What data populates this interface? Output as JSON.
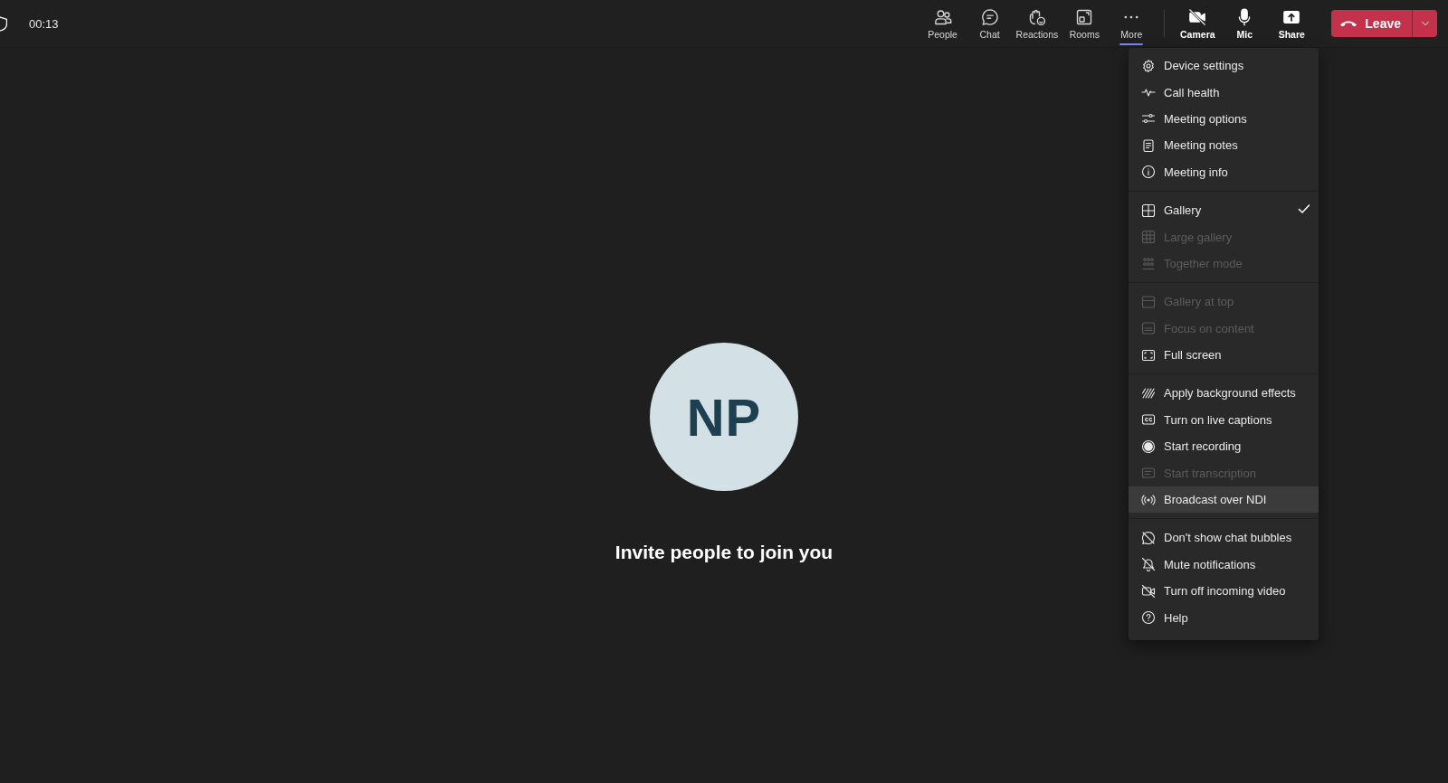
{
  "call": {
    "timer": "00:13"
  },
  "toolbar": [
    {
      "label": "People",
      "selected": false
    },
    {
      "label": "Chat",
      "selected": false
    },
    {
      "label": "Reactions",
      "selected": false
    },
    {
      "label": "Rooms",
      "selected": false
    },
    {
      "label": "More",
      "selected": true
    }
  ],
  "device_controls": [
    {
      "label": "Camera"
    },
    {
      "label": "Mic"
    },
    {
      "label": "Share"
    }
  ],
  "leave_button": {
    "label": "Leave"
  },
  "more_menu": {
    "groups": [
      {
        "items": [
          {
            "label": "Device settings",
            "checked": false,
            "disabled": false,
            "highlighted": false
          },
          {
            "label": "Call health",
            "checked": false,
            "disabled": false,
            "highlighted": false
          },
          {
            "label": "Meeting options",
            "checked": false,
            "disabled": false,
            "highlighted": false
          },
          {
            "label": "Meeting notes",
            "checked": false,
            "disabled": false,
            "highlighted": false
          },
          {
            "label": "Meeting info",
            "checked": false,
            "disabled": false,
            "highlighted": false
          }
        ]
      },
      {
        "items": [
          {
            "label": "Gallery",
            "checked": true,
            "disabled": false,
            "highlighted": false
          },
          {
            "label": "Large gallery",
            "checked": false,
            "disabled": true,
            "highlighted": false
          },
          {
            "label": "Together mode",
            "checked": false,
            "disabled": true,
            "highlighted": false
          }
        ]
      },
      {
        "items": [
          {
            "label": "Gallery at top",
            "checked": false,
            "disabled": true,
            "highlighted": false
          },
          {
            "label": "Focus on content",
            "checked": false,
            "disabled": true,
            "highlighted": false
          },
          {
            "label": "Full screen",
            "checked": false,
            "disabled": false,
            "highlighted": false
          }
        ]
      },
      {
        "items": [
          {
            "label": "Apply background effects",
            "checked": false,
            "disabled": false,
            "highlighted": false
          },
          {
            "label": "Turn on live captions",
            "checked": false,
            "disabled": false,
            "highlighted": false
          },
          {
            "label": "Start recording",
            "checked": false,
            "disabled": false,
            "highlighted": false
          },
          {
            "label": "Start transcription",
            "checked": false,
            "disabled": true,
            "highlighted": false
          },
          {
            "label": "Broadcast over NDI",
            "checked": false,
            "disabled": false,
            "highlighted": true
          }
        ]
      },
      {
        "items": [
          {
            "label": "Don't show chat bubbles",
            "checked": false,
            "disabled": false,
            "highlighted": false
          },
          {
            "label": "Mute notifications",
            "checked": false,
            "disabled": false,
            "highlighted": false
          },
          {
            "label": "Turn off incoming video",
            "checked": false,
            "disabled": false,
            "highlighted": false
          },
          {
            "label": "Help",
            "checked": false,
            "disabled": false,
            "highlighted": false
          }
        ]
      }
    ]
  },
  "stage": {
    "avatar_initials": "NP",
    "invite_text": "Invite people to join you"
  }
}
